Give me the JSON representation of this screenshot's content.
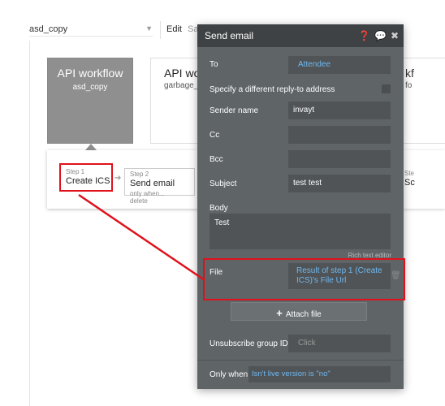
{
  "topbar": {
    "app_name": "asd_copy",
    "menu_edit": "Edit",
    "menu_partial": "Sa"
  },
  "workflows": {
    "selected": {
      "title": "API workflow",
      "subtitle": "asd_copy"
    },
    "second": {
      "title": "API wor",
      "subtitle": "garbage_c"
    },
    "third": {
      "title": "kf",
      "subtitle": "fo"
    }
  },
  "steps": {
    "step1": {
      "num": "Step 1",
      "name": "Create ICS"
    },
    "step2": {
      "num": "Step 2",
      "name": "Send email",
      "only_when": "only when...",
      "delete": "delete"
    },
    "step_right": {
      "num": "Ste",
      "name": "Sc"
    }
  },
  "dialog": {
    "title": "Send email",
    "icons": [
      "help-icon",
      "comment-icon",
      "close-icon"
    ],
    "to_label": "To",
    "to_value": "Attendee",
    "reply_to_label": "Specify a different reply-to address",
    "sender_name_label": "Sender name",
    "sender_name_value": "invayt",
    "cc_label": "Cc",
    "bcc_label": "Bcc",
    "subject_label": "Subject",
    "subject_value": "test test",
    "body_label": "Body",
    "body_value": "Test",
    "rich_text_editor": "Rich text editor",
    "file_label": "File",
    "file_value": "Result of step 1 (Create ICS)'s File Url",
    "attach_file": "Attach file",
    "unsubscribe_label": "Unsubscribe group ID",
    "unsubscribe_placeholder": "Click",
    "only_when_label": "Only when",
    "only_when_value": "Isn't live version is \"no\""
  },
  "colors": {
    "dialog_bg": "#5f6467",
    "dialog_header": "#3e4244",
    "link_blue": "#6fb8f0",
    "highlight_red": "#e0111b",
    "selected_card": "#8f8f8f"
  }
}
